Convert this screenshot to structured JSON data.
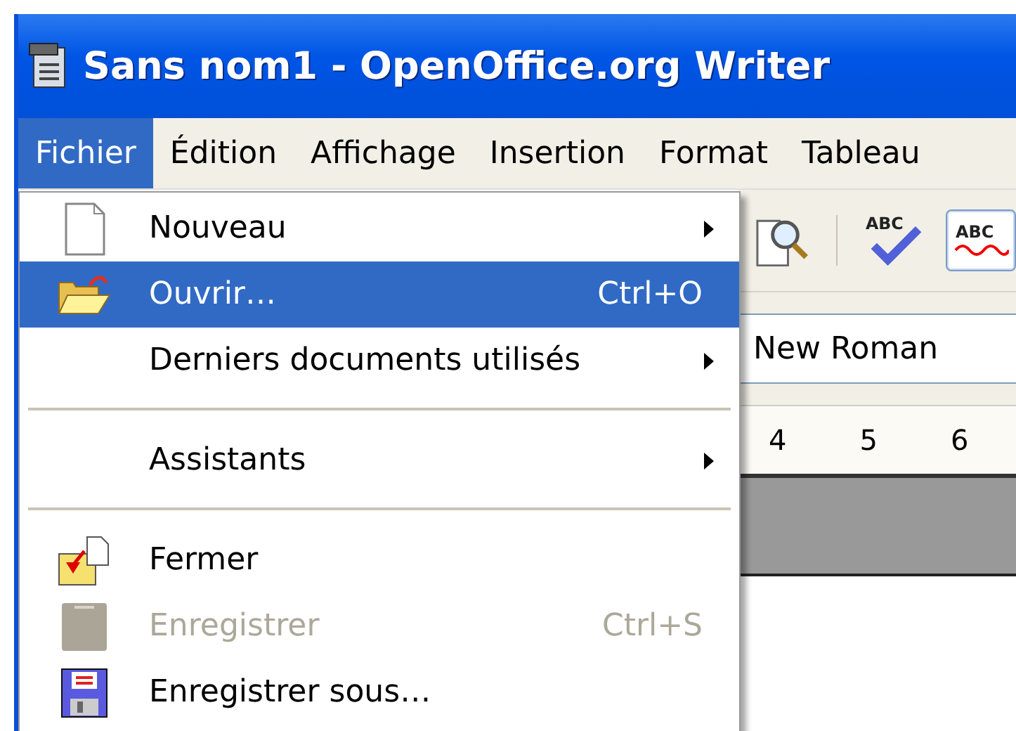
{
  "window": {
    "title": "Sans nom1 - OpenOffice.org Writer"
  },
  "menu_bar": [
    {
      "label": "Fichier",
      "selected": true
    },
    {
      "label": "Édition",
      "selected": false
    },
    {
      "label": "Affichage",
      "selected": false
    },
    {
      "label": "Insertion",
      "selected": false
    },
    {
      "label": "Format",
      "selected": false
    },
    {
      "label": "Tableau",
      "selected": false
    }
  ],
  "file_menu": [
    {
      "kind": "item",
      "label": "Nouveau",
      "submenu": true,
      "selected": false,
      "disabled": false
    },
    {
      "kind": "item",
      "label": "Ouvrir…",
      "shortcut": "Ctrl+O",
      "submenu": false,
      "selected": true,
      "disabled": false
    },
    {
      "kind": "item",
      "label": "Derniers documents utilisés",
      "submenu": true,
      "selected": false,
      "disabled": false
    },
    {
      "kind": "separator"
    },
    {
      "kind": "item",
      "label": "Assistants",
      "submenu": true,
      "selected": false,
      "disabled": false
    },
    {
      "kind": "separator"
    },
    {
      "kind": "item",
      "label": "Fermer",
      "submenu": false,
      "selected": false,
      "disabled": false
    },
    {
      "kind": "item",
      "label": "Enregistrer",
      "shortcut": "Ctrl+S",
      "submenu": false,
      "selected": false,
      "disabled": true
    },
    {
      "kind": "item",
      "label": "Enregistrer sous…",
      "submenu": false,
      "selected": false,
      "disabled": false
    }
  ],
  "toolbar": {
    "spellcheck_label": "ABC",
    "auto_spellcheck_label": "ABC",
    "auto_spellcheck_on": true
  },
  "font_field": {
    "value": "New Roman"
  },
  "ruler": {
    "labels": [
      "4",
      "5",
      "6"
    ]
  }
}
